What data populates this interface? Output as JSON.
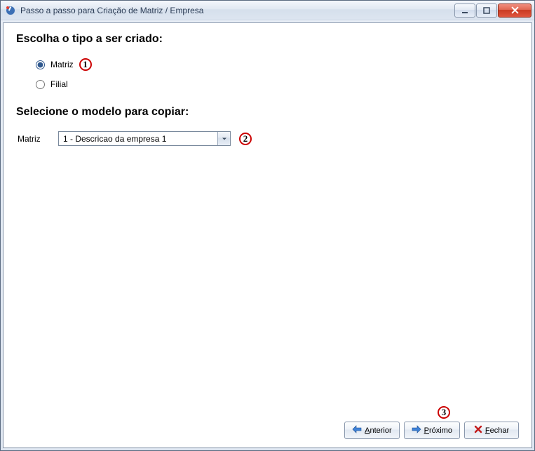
{
  "window": {
    "title": "Passo a passo para Criação de Matriz / Empresa"
  },
  "headings": {
    "choose_type": "Escolha o tipo a ser criado:",
    "select_model": "Selecione o modelo para copiar:"
  },
  "radios": {
    "matriz": {
      "label": "Matriz",
      "checked": true
    },
    "filial": {
      "label": "Filial",
      "checked": false
    }
  },
  "model": {
    "label": "Matriz",
    "selected": "1 - Descricao da empresa 1"
  },
  "callouts": {
    "matriz": "1",
    "combo": "2",
    "next": "3"
  },
  "buttons": {
    "previous": {
      "hotkey": "A",
      "rest": "nterior"
    },
    "next": {
      "hotkey": "P",
      "rest": "róximo"
    },
    "close": {
      "hotkey": "F",
      "rest": "echar"
    }
  }
}
